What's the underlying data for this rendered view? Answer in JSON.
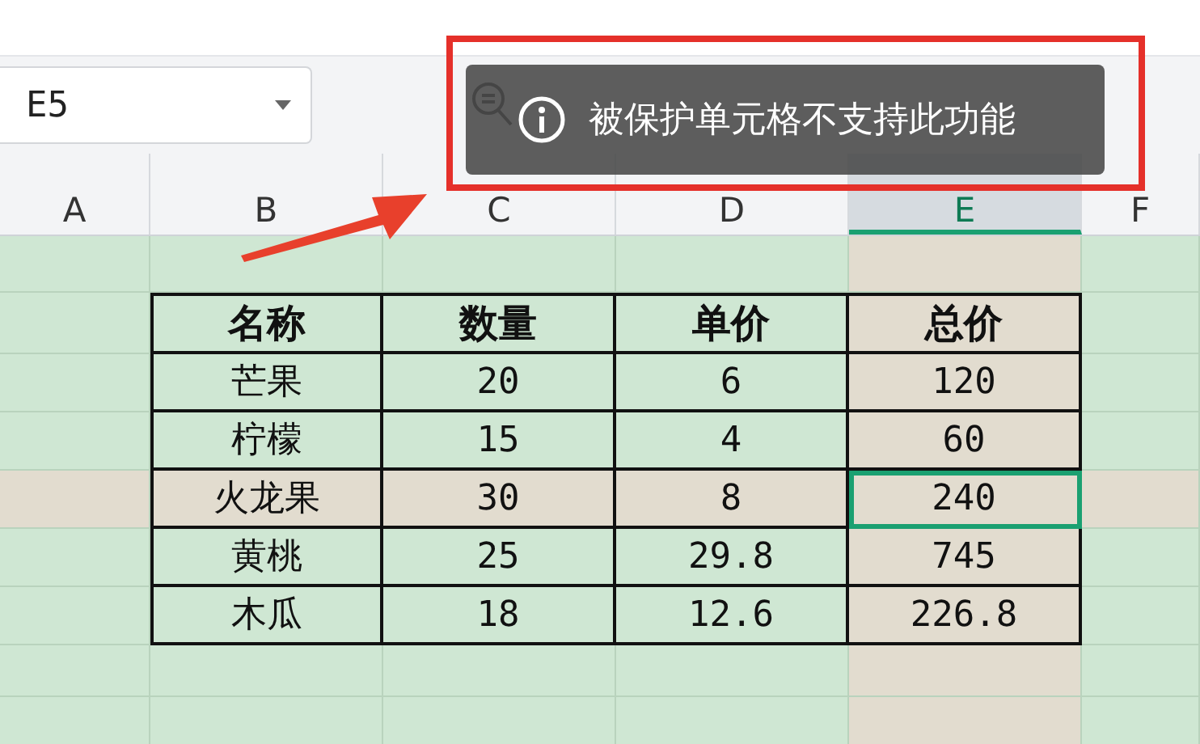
{
  "name_box": {
    "value": "E5"
  },
  "toast": {
    "message": "被保护单元格不支持此功能"
  },
  "columns": [
    {
      "label": "A",
      "selected": false
    },
    {
      "label": "B",
      "selected": false
    },
    {
      "label": "C",
      "selected": false
    },
    {
      "label": "D",
      "selected": false
    },
    {
      "label": "E",
      "selected": true
    },
    {
      "label": "F",
      "selected": false
    }
  ],
  "table": {
    "header": [
      "名称",
      "数量",
      "单价",
      "总价"
    ],
    "rows": [
      {
        "selected": false,
        "cells": [
          {
            "text": "芒果",
            "active": false
          },
          {
            "text": "20",
            "active": false
          },
          {
            "text": "6",
            "active": false
          },
          {
            "text": "120",
            "active": false
          }
        ]
      },
      {
        "selected": false,
        "cells": [
          {
            "text": "柠檬",
            "active": false
          },
          {
            "text": "15",
            "active": false
          },
          {
            "text": "4",
            "active": false
          },
          {
            "text": "60",
            "active": false
          }
        ]
      },
      {
        "selected": true,
        "cells": [
          {
            "text": "火龙果",
            "active": false
          },
          {
            "text": "30",
            "active": false
          },
          {
            "text": "8",
            "active": false
          },
          {
            "text": "240",
            "active": true
          }
        ]
      },
      {
        "selected": false,
        "cells": [
          {
            "text": "黄桃",
            "active": false
          },
          {
            "text": "25",
            "active": false
          },
          {
            "text": "29.8",
            "active": false
          },
          {
            "text": "745",
            "active": false
          }
        ]
      },
      {
        "selected": false,
        "cells": [
          {
            "text": "木瓜",
            "active": false
          },
          {
            "text": "18",
            "active": false
          },
          {
            "text": "12.6",
            "active": false
          },
          {
            "text": "226.8",
            "active": false
          }
        ]
      }
    ]
  }
}
